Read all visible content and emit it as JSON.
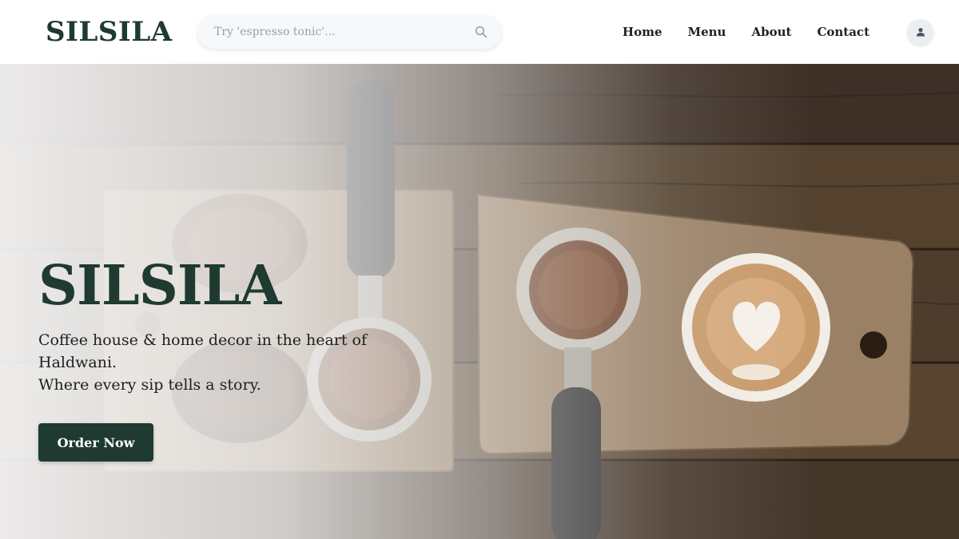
{
  "brand": {
    "name": "SILSILA"
  },
  "search": {
    "placeholder": "Try 'espresso tonic'...",
    "icon": "search-icon"
  },
  "nav": {
    "items": [
      {
        "label": "Home"
      },
      {
        "label": "Menu"
      },
      {
        "label": "About"
      },
      {
        "label": "Contact"
      }
    ]
  },
  "user": {
    "icon": "user-icon"
  },
  "hero": {
    "title": "SILSILA",
    "subtitle_line1": "Coffee house & home decor in the heart of Haldwani.",
    "subtitle_line2": "Where every sip tells a story.",
    "cta_label": "Order Now",
    "image": "coffee-boards-photo"
  },
  "colors": {
    "brand_green": "#1e3a31",
    "header_bg": "#ffffff",
    "search_bg": "#f7f8fa"
  }
}
